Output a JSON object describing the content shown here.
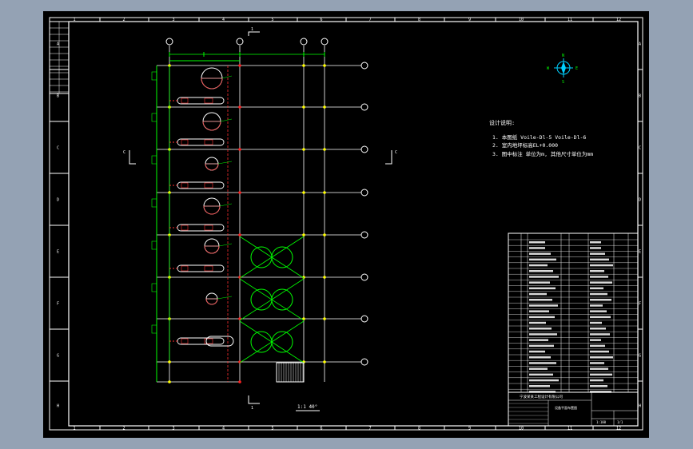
{
  "colors": {
    "background": "#94a2b4",
    "sheet": "#000000",
    "frame": "#ffffff",
    "grid_line": "#ffffff",
    "pipe_green": "#00ff00",
    "node_red": "#ff2020",
    "node_yellow": "#ffff00",
    "dashed_red": "#ff3030",
    "compass": "#00d0ff"
  },
  "border": {
    "col_labels": [
      "1",
      "2",
      "3",
      "4",
      "5",
      "6",
      "7",
      "8",
      "9",
      "10",
      "11",
      "12"
    ],
    "row_labels": [
      "A",
      "B",
      "C",
      "D",
      "E",
      "F",
      "G",
      "H"
    ]
  },
  "drawing": {
    "section_marks": {
      "top": "1",
      "bottom": "1",
      "left": "C",
      "right": "C"
    },
    "plan_caption": "1:1 40°",
    "notes_title": "设计说明:",
    "notes": [
      "1. 本图纸 Voile-Dl-5 Voile-Dl-6",
      "2. 室内地坪标高EL+0.000",
      "3. 图中标注 单位为m, 其他尺寸单位为mm"
    ],
    "compass_labels": {
      "n": "N",
      "s": "S",
      "e": "E",
      "w": "W"
    }
  },
  "title_block": {
    "company": "宁波某某工程设计有限公司",
    "drawing_name": "设备平面布置图",
    "scale": "1:100",
    "sheet": "1/1"
  }
}
